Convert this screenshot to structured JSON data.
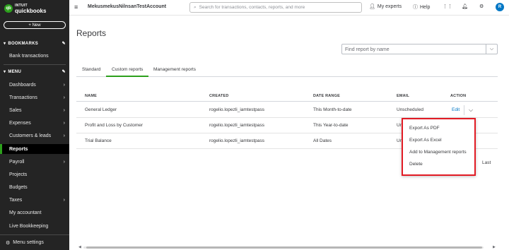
{
  "brand": {
    "line1": "INTUIT",
    "line2": "quickbooks",
    "mark": "qb"
  },
  "sidebar": {
    "new_label": "+ New",
    "bookmarks_label": "BOOKMARKS",
    "bookmark_items": [
      {
        "label": "Bank transactions"
      }
    ],
    "menu_label": "MENU",
    "menu_items": [
      {
        "label": "Dashboards"
      },
      {
        "label": "Transactions"
      },
      {
        "label": "Sales"
      },
      {
        "label": "Expenses"
      },
      {
        "label": "Customers & leads"
      },
      {
        "label": "Reports"
      },
      {
        "label": "Payroll"
      },
      {
        "label": "Projects"
      },
      {
        "label": "Budgets"
      },
      {
        "label": "Taxes"
      },
      {
        "label": "My accountant"
      },
      {
        "label": "Live Bookkeeping"
      }
    ],
    "menu_settings_label": "Menu settings",
    "accent": "#2ca01c"
  },
  "topbar": {
    "company": "MekusmekusNilnsanTestAccount",
    "search_placeholder": "Search for transactions, contacts, reports, and more",
    "my_experts": "My experts",
    "help": "Help",
    "avatar_initial": "R"
  },
  "page": {
    "title": "Reports",
    "find_placeholder": "Find report by name",
    "tabs": [
      {
        "label": "Standard"
      },
      {
        "label": "Custom reports"
      },
      {
        "label": "Management reports"
      }
    ],
    "columns": [
      "NAME",
      "CREATED",
      "DATE RANGE",
      "EMAIL",
      "ACTION"
    ],
    "rows": [
      {
        "name": "General Ledger",
        "created": "rogelio.lopezli_iamtestpass",
        "date_range": "This Month-to-date",
        "email": "Unscheduled",
        "action": "Edit"
      },
      {
        "name": "Profit and Loss by Customer",
        "created": "rogelio.lopezli_iamtestpass",
        "date_range": "This Year-to-date",
        "email": "Uns"
      },
      {
        "name": "Trial Balance",
        "created": "rogelio.lopezli_iamtestpass",
        "date_range": "All Dates",
        "email": "Uns"
      }
    ],
    "action_menu": [
      {
        "label": "Export As PDF"
      },
      {
        "label": "Export As Excel"
      },
      {
        "label": "Add to Management reports"
      },
      {
        "label": "Delete"
      }
    ],
    "pager_last": "Last",
    "link_color": "#0077c5",
    "highlight_color": "#e21b24"
  }
}
